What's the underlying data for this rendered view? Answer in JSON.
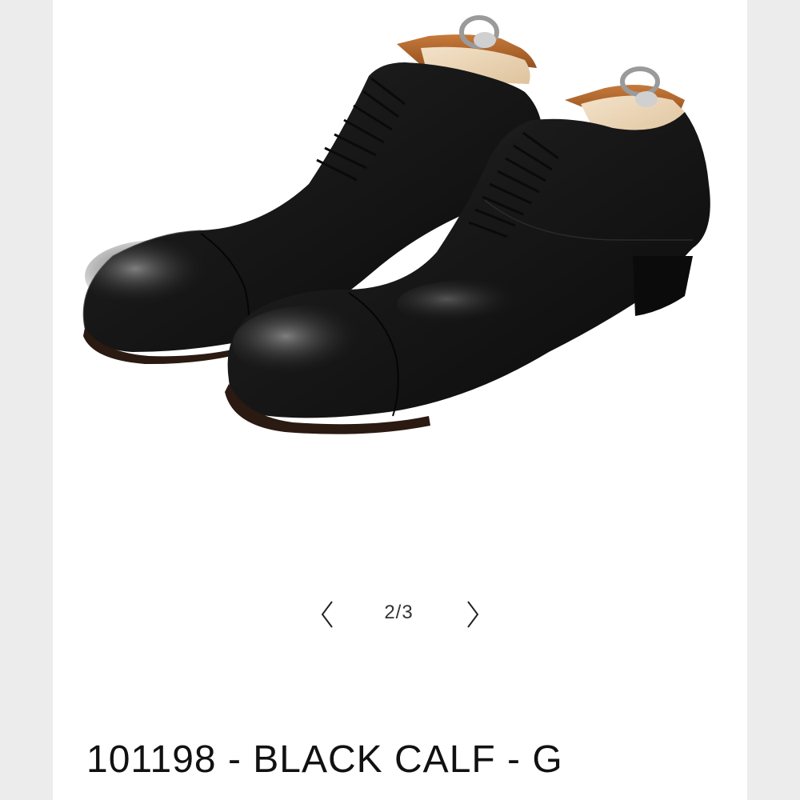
{
  "gallery": {
    "image_alt": "Black calf cap-toe oxford shoes with wooden shoe trees",
    "pager_current": "2",
    "pager_total": "3",
    "pager_text": "2/3"
  },
  "product": {
    "title": "101198 - BLACK CALF - G"
  },
  "icons": {
    "prev": "chevron-left-icon",
    "next": "chevron-right-icon"
  },
  "colors": {
    "background": "#ffffff",
    "side_bars": "#ececec",
    "leather": "#141414",
    "shoe_tree": "#e9d3b6",
    "lining": "#b96a2c"
  }
}
